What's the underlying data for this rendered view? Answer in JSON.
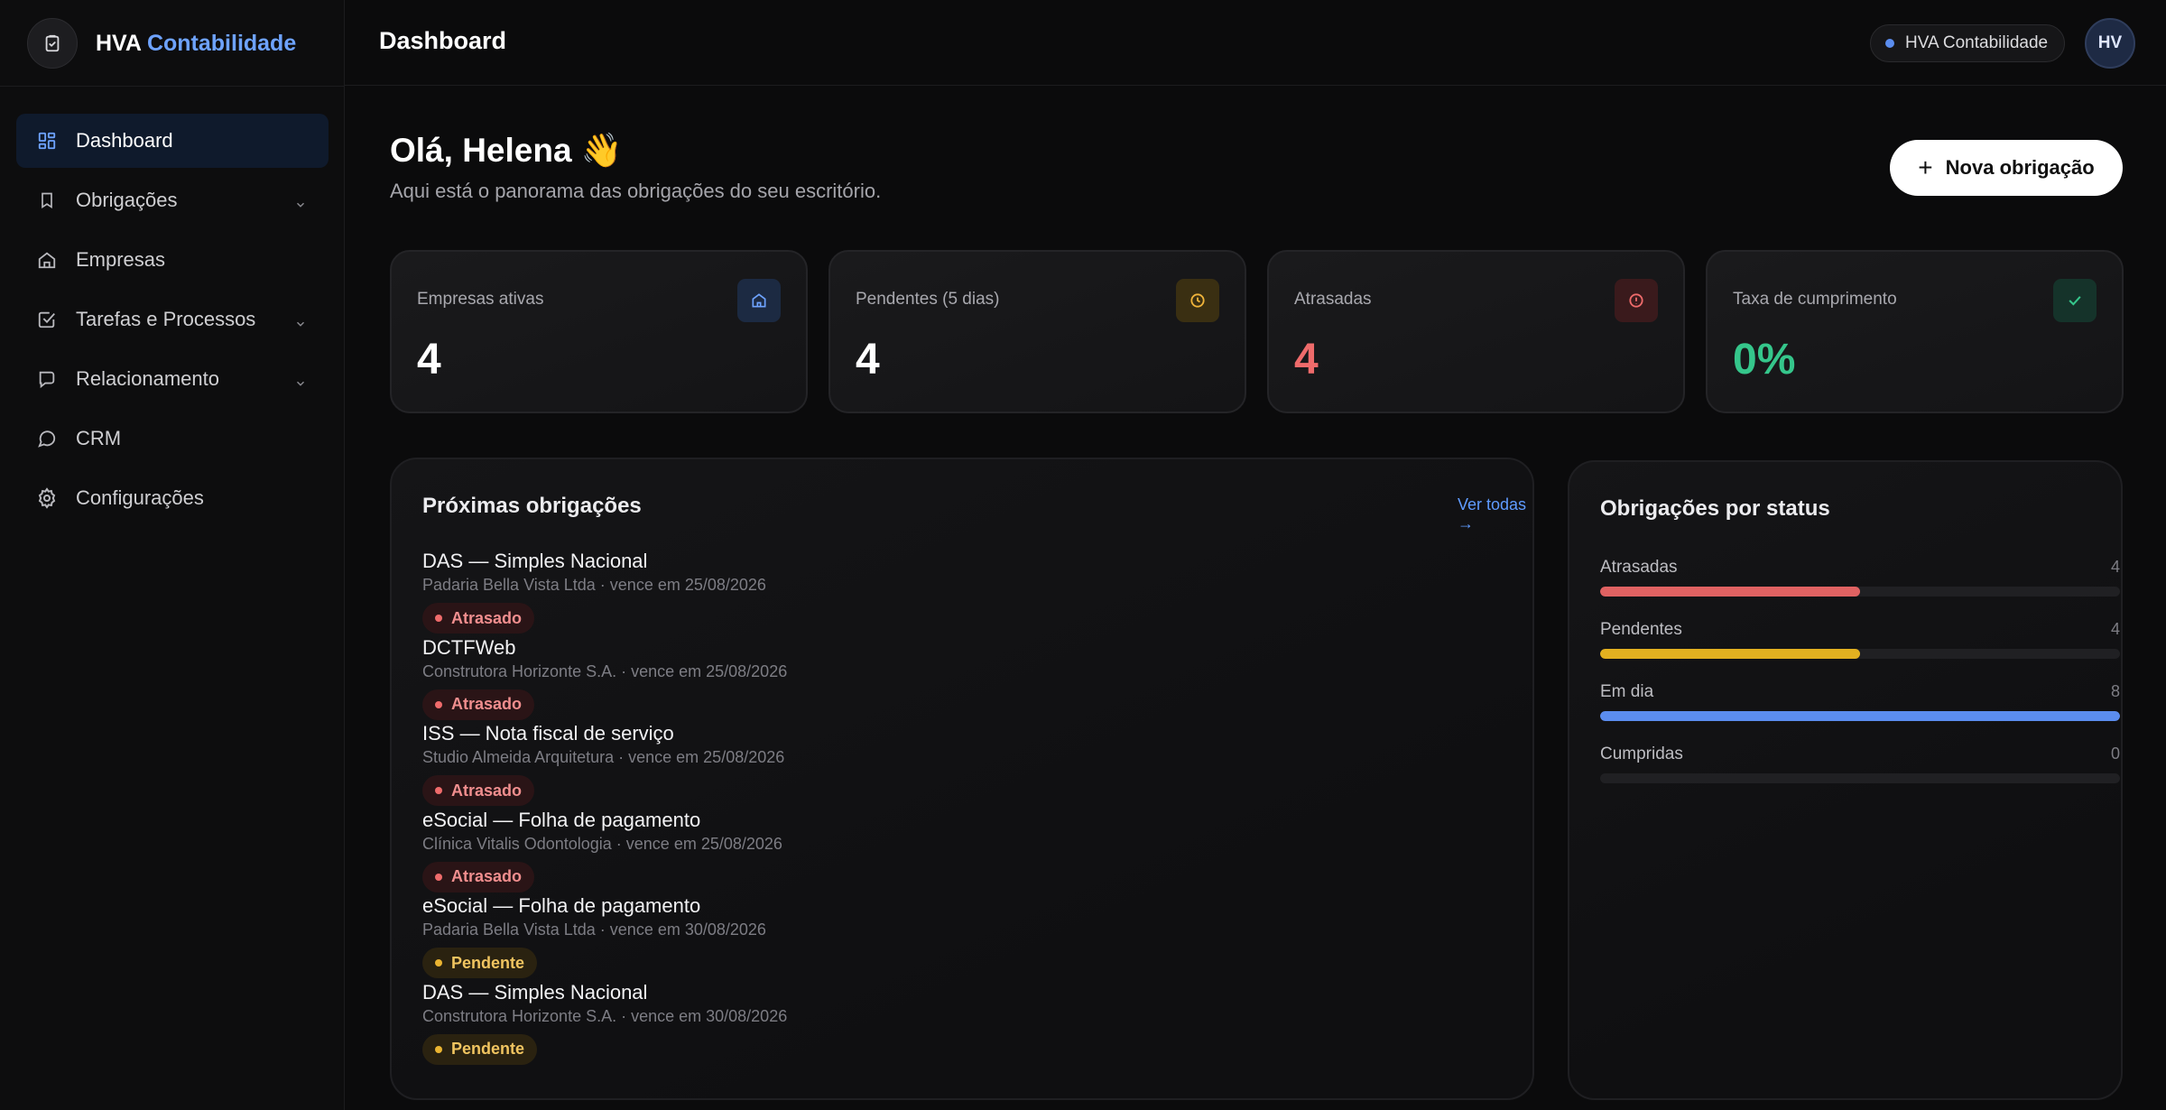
{
  "brand": {
    "name_part1": "HVA",
    "name_part2": "Contabilidade"
  },
  "sidebar": {
    "items": [
      {
        "label": "Dashboard",
        "icon": "layout-dashboard-icon",
        "active": true,
        "expandable": false
      },
      {
        "label": "Obrigações",
        "icon": "bookmark-icon",
        "active": false,
        "expandable": true
      },
      {
        "label": "Empresas",
        "icon": "home-icon",
        "active": false,
        "expandable": false
      },
      {
        "label": "Tarefas e Processos",
        "icon": "checkbox-icon",
        "active": false,
        "expandable": true
      },
      {
        "label": "Relacionamento",
        "icon": "message-square-icon",
        "active": false,
        "expandable": true
      },
      {
        "label": "CRM",
        "icon": "message-circle-icon",
        "active": false,
        "expandable": false
      },
      {
        "label": "Configurações",
        "icon": "gear-icon",
        "active": false,
        "expandable": false
      }
    ]
  },
  "header": {
    "title": "Dashboard",
    "org_label": "HVA Contabilidade",
    "avatar_initials": "HV"
  },
  "greeting": {
    "title": "Olá, Helena 👋",
    "subtitle": "Aqui está o panorama das obrigações do seu escritório.",
    "new_button": "Nova obrigação"
  },
  "stats": [
    {
      "label": "Empresas ativas",
      "value": "4",
      "icon": "building-icon",
      "value_color": "#ffffff",
      "icon_color": "#6ea3ff",
      "icon_bg": "#1c2a42"
    },
    {
      "label": "Pendentes (5 dias)",
      "value": "4",
      "icon": "clock-icon",
      "value_color": "#ffffff",
      "icon_color": "#f0b43a",
      "icon_bg": "#3a2f12"
    },
    {
      "label": "Atrasadas",
      "value": "4",
      "icon": "alert-circle-icon",
      "value_color": "#ef6b6b",
      "icon_color": "#ef6b6b",
      "icon_bg": "#3a1a1c"
    },
    {
      "label": "Taxa de cumprimento",
      "value": "0%",
      "icon": "check-icon",
      "value_color": "#35c68b",
      "icon_color": "#35c68b",
      "icon_bg": "#15332a"
    }
  ],
  "upcoming": {
    "title": "Próximas obrigações",
    "view_all": "Ver todas →",
    "items": [
      {
        "name": "DAS — Simples Nacional",
        "meta": "Padaria Bella Vista Ltda · vence em 25/08/2026",
        "status": "Atrasado",
        "kind": "late"
      },
      {
        "name": "DCTFWeb",
        "meta": "Construtora Horizonte S.A. · vence em 25/08/2026",
        "status": "Atrasado",
        "kind": "late"
      },
      {
        "name": "ISS — Nota fiscal de serviço",
        "meta": "Studio Almeida Arquitetura · vence em 25/08/2026",
        "status": "Atrasado",
        "kind": "late"
      },
      {
        "name": "eSocial — Folha de pagamento",
        "meta": "Clínica Vitalis Odontologia · vence em 25/08/2026",
        "status": "Atrasado",
        "kind": "late"
      },
      {
        "name": "eSocial — Folha de pagamento",
        "meta": "Padaria Bella Vista Ltda · vence em 30/08/2026",
        "status": "Pendente",
        "kind": "pend"
      },
      {
        "name": "DAS — Simples Nacional",
        "meta": "Construtora Horizonte S.A. · vence em 30/08/2026",
        "status": "Pendente",
        "kind": "pend"
      }
    ]
  },
  "status_panel": {
    "title": "Obrigações por status",
    "max": 8,
    "rows": [
      {
        "label": "Atrasadas",
        "count": 4,
        "color": "#e06262"
      },
      {
        "label": "Pendentes",
        "count": 4,
        "color": "#e2b020"
      },
      {
        "label": "Em dia",
        "count": 8,
        "color": "#5b8def"
      },
      {
        "label": "Cumpridas",
        "count": 0,
        "color": "#35c68b"
      }
    ]
  }
}
